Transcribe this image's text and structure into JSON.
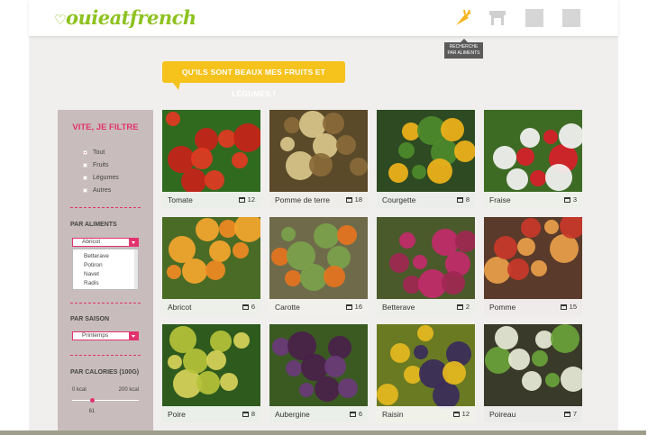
{
  "header": {
    "logo": "ouieatfrench",
    "nav": [
      {
        "icon": "carrot-icon",
        "tooltip": "Recherche par aliments"
      },
      {
        "icon": "market-stall-icon"
      },
      {
        "icon": "placeholder-icon"
      },
      {
        "icon": "placeholder-icon"
      }
    ]
  },
  "banner": "QU'ILS SONT BEAUX MES FRUITS ET LÉGUMES !",
  "sidebar": {
    "title": "VITE, JE FILTRE",
    "types": [
      {
        "label": "Tout",
        "checked": true
      },
      {
        "label": "Fruits",
        "checked": false
      },
      {
        "label": "Légumes",
        "checked": false
      },
      {
        "label": "Autres",
        "checked": false
      }
    ],
    "aliments_label": "PAR ALIMENTS",
    "aliments_selected": "Abricot",
    "aliments_options": [
      "Betterave",
      "Potiron",
      "Navet",
      "Radis"
    ],
    "saison_label": "PAR SAISON",
    "saison_selected": "Printemps",
    "calories_label": "PAR CALORIES (100G)",
    "cal_min": "0 kcal",
    "cal_max": "200 kcal",
    "cal_value": "61",
    "cal_fraction": 0.305
  },
  "products": [
    {
      "name": "Tomate",
      "count": "12",
      "palette": [
        "#2f6a1f",
        "#c8231a",
        "#e23a22"
      ]
    },
    {
      "name": "Pomme de terre",
      "count": "18",
      "palette": [
        "#5a4a2a",
        "#d8c58a",
        "#8a6a3a"
      ]
    },
    {
      "name": "Courgette",
      "count": "8",
      "palette": [
        "#2d4a22",
        "#4e8a2c",
        "#f0b21a"
      ]
    },
    {
      "name": "Fraise",
      "count": "3",
      "palette": [
        "#3e6b24",
        "#d81f2a",
        "#f4f4f4"
      ]
    },
    {
      "name": "Abricot",
      "count": "6",
      "palette": [
        "#4a6b25",
        "#f08a22",
        "#f4a62e"
      ]
    },
    {
      "name": "Carotte",
      "count": "16",
      "palette": [
        "#6f6b4a",
        "#e5741e",
        "#7aa24a"
      ]
    },
    {
      "name": "Betterave",
      "count": "2",
      "palette": [
        "#4a5a2a",
        "#a02752",
        "#c22a6a"
      ]
    },
    {
      "name": "Pomme",
      "count": "15",
      "palette": [
        "#5a3a2a",
        "#c8382a",
        "#e8a04a"
      ]
    },
    {
      "name": "Poire",
      "count": "8",
      "palette": [
        "#2e5a1e",
        "#b5c23a",
        "#d8d35a"
      ]
    },
    {
      "name": "Aubergine",
      "count": "6",
      "palette": [
        "#3a5a22",
        "#4a1f4a",
        "#6a3a7a"
      ]
    },
    {
      "name": "Raisin",
      "count": "12",
      "palette": [
        "#6a7a22",
        "#3a2a5a",
        "#e6b81f"
      ]
    },
    {
      "name": "Poireau",
      "count": "7",
      "palette": [
        "#3a3a2a",
        "#6aa23a",
        "#e8ecd8"
      ]
    }
  ]
}
